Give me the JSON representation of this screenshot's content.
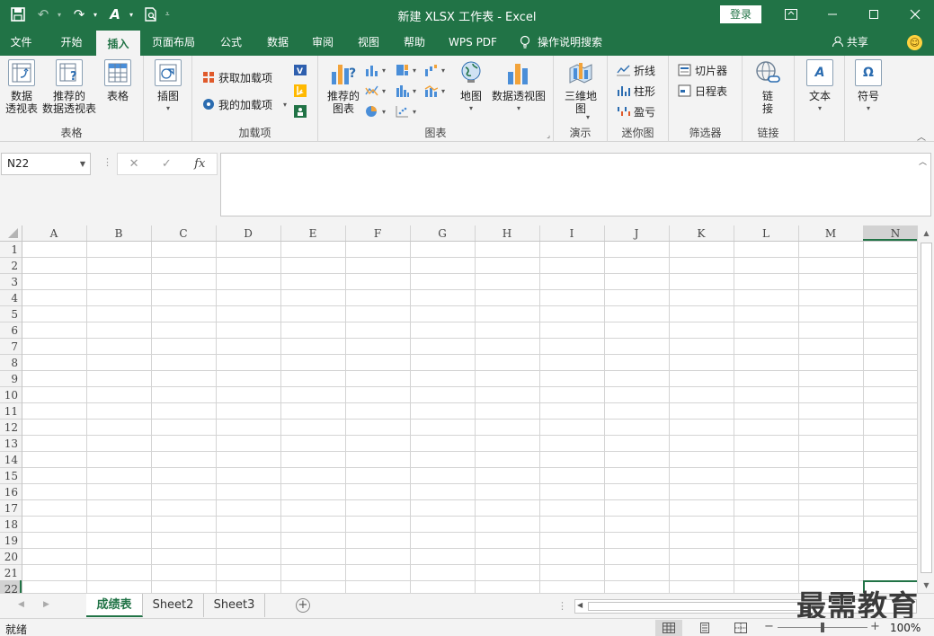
{
  "titlebar": {
    "title": "新建 XLSX 工作表 - Excel",
    "login": "登录",
    "qat": [
      {
        "name": "save-icon",
        "glyph": "💾"
      },
      {
        "name": "undo-icon",
        "glyph": "↶"
      },
      {
        "name": "redo-icon",
        "glyph": "↷"
      },
      {
        "name": "font-color-icon",
        "glyph": "A"
      },
      {
        "name": "print-preview-icon",
        "glyph": "🗋"
      }
    ]
  },
  "tabs": [
    "文件",
    "开始",
    "插入",
    "页面布局",
    "公式",
    "数据",
    "审阅",
    "视图",
    "帮助",
    "WPS PDF"
  ],
  "active_tab": "插入",
  "tellme": "操作说明搜索",
  "share": "共享",
  "ribbon": {
    "table_group": {
      "label": "表格",
      "pivot": "数据\n透视表",
      "recommended_pivot": "推荐的\n数据透视表",
      "table": "表格"
    },
    "illustrations": {
      "label": "插图"
    },
    "addins": {
      "label": "加载项",
      "get": "获取加载项",
      "my": "我的加载项"
    },
    "charts": {
      "label": "图表",
      "recommended": "推荐的\n图表",
      "maps": "地图",
      "pivotchart": "数据透视图"
    },
    "tours": {
      "label": "演示",
      "map3d": "三维地\n图"
    },
    "sparklines": {
      "label": "迷你图",
      "line": "折线",
      "column": "柱形",
      "winloss": "盈亏"
    },
    "filters": {
      "label": "筛选器",
      "slicer": "切片器",
      "timeline": "日程表"
    },
    "links": {
      "label": "链接",
      "link": "链\n接"
    },
    "text": {
      "label": "文本"
    },
    "symbols": {
      "label": "符号"
    }
  },
  "formula_bar": {
    "name_box": "N22",
    "fx": "fx",
    "cancel": "✕",
    "enter": "✓"
  },
  "grid": {
    "columns": [
      "A",
      "B",
      "C",
      "D",
      "E",
      "F",
      "G",
      "H",
      "I",
      "J",
      "K",
      "L",
      "M",
      "N"
    ],
    "rows": [
      "1",
      "2",
      "3",
      "4",
      "5",
      "6",
      "7",
      "8",
      "9",
      "10",
      "11",
      "12",
      "13",
      "14",
      "15",
      "16",
      "17",
      "18",
      "19",
      "20",
      "21",
      "22"
    ],
    "selected_column": "N",
    "selected_row": "22",
    "colors": {
      "selected": "#217346",
      "gridline": "#d4d4d4",
      "header": "#f3f3f3"
    }
  },
  "sheets": [
    "成绩表",
    "Sheet2",
    "Sheet3"
  ],
  "active_sheet": "成绩表",
  "watermark": "最需教育",
  "status": {
    "ready": "就绪",
    "zoom": "100%"
  },
  "zoom_fraction": 0.5
}
